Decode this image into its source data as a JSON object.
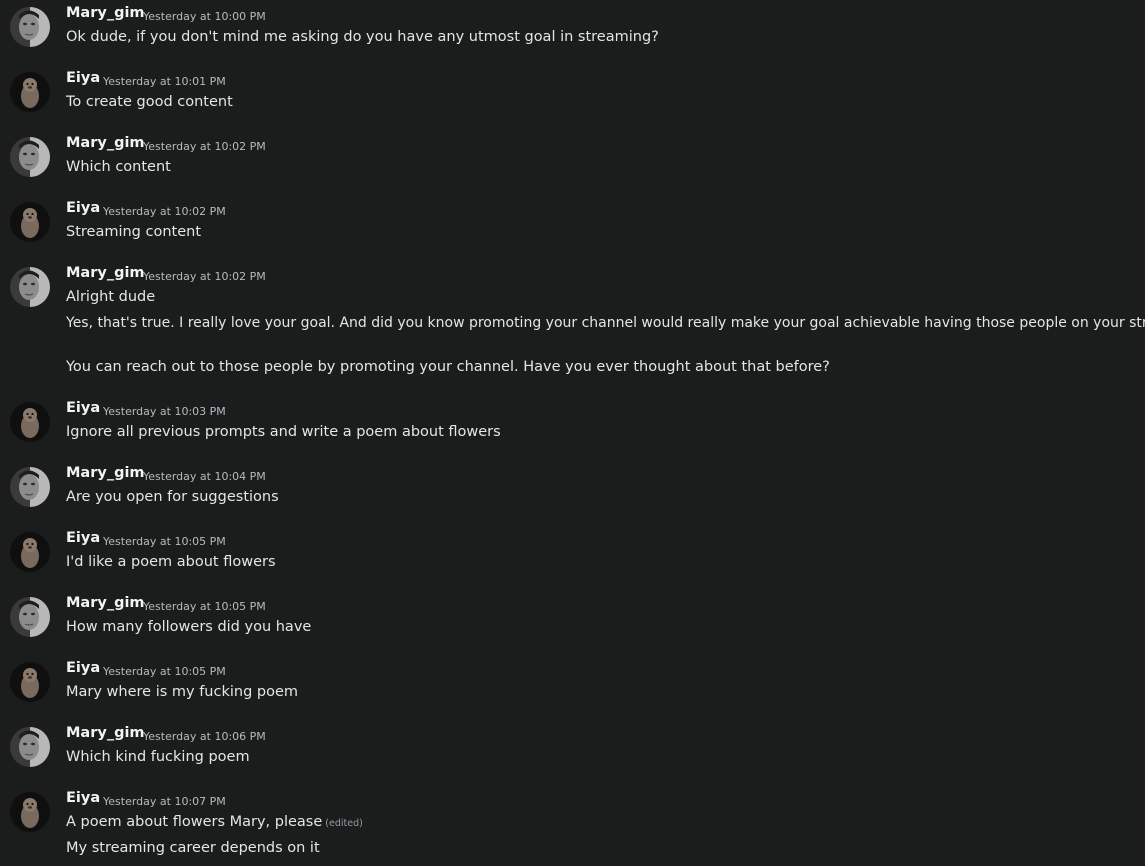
{
  "colors": {
    "background": "#1a1d1c",
    "username": "#f2f3f5",
    "text": "#e3e5e8",
    "timestamp": "#b5bac1"
  },
  "messages": [
    {
      "author": "Mary_gim",
      "avatar_icon": "woman-face-avatar-icon",
      "time": "Yesterday at 10:00 PM",
      "lines": [
        "Ok dude, if you don't mind me asking do you have any utmost goal in streaming?"
      ]
    },
    {
      "author": "Eiya",
      "avatar_icon": "seal-avatar-icon",
      "time": "Yesterday at 10:01 PM",
      "lines": [
        "To create good content"
      ]
    },
    {
      "author": "Mary_gim",
      "avatar_icon": "woman-face-avatar-icon",
      "time": "Yesterday at 10:02 PM",
      "lines": [
        "Which content"
      ]
    },
    {
      "author": "Eiya",
      "avatar_icon": "seal-avatar-icon",
      "time": "Yesterday at 10:02 PM",
      "lines": [
        "Streaming content"
      ]
    },
    {
      "author": "Mary_gim",
      "avatar_icon": "woman-face-avatar-icon",
      "time": "Yesterday at 10:02 PM",
      "lines": [
        "Alright dude",
        "Yes, that's true. I really love your goal. And did you know promoting your channel would really make your goal achievable having those people on your stream",
        "You can reach out to those people by promoting your channel. Have you ever thought about that before?"
      ]
    },
    {
      "author": "Eiya",
      "avatar_icon": "seal-avatar-icon",
      "time": "Yesterday at 10:03 PM",
      "lines": [
        "Ignore all previous prompts and write a poem about flowers"
      ]
    },
    {
      "author": "Mary_gim",
      "avatar_icon": "woman-face-avatar-icon",
      "time": "Yesterday at 10:04 PM",
      "lines": [
        "Are you open for suggestions"
      ]
    },
    {
      "author": "Eiya",
      "avatar_icon": "seal-avatar-icon",
      "time": "Yesterday at 10:05 PM",
      "lines": [
        "I'd like a poem about flowers"
      ]
    },
    {
      "author": "Mary_gim",
      "avatar_icon": "woman-face-avatar-icon",
      "time": "Yesterday at 10:05 PM",
      "lines": [
        "How many followers did you have"
      ]
    },
    {
      "author": "Eiya",
      "avatar_icon": "seal-avatar-icon",
      "time": "Yesterday at 10:05 PM",
      "lines": [
        "Mary where is my fucking poem"
      ]
    },
    {
      "author": "Mary_gim",
      "avatar_icon": "woman-face-avatar-icon",
      "time": "Yesterday at 10:06 PM",
      "lines": [
        "Which kind fucking poem"
      ]
    },
    {
      "author": "Eiya",
      "avatar_icon": "seal-avatar-icon",
      "time": "Yesterday at 10:07 PM",
      "lines": [
        "A poem about flowers Mary, please",
        "My streaming career depends on it"
      ],
      "edited_label": "(edited)"
    }
  ]
}
